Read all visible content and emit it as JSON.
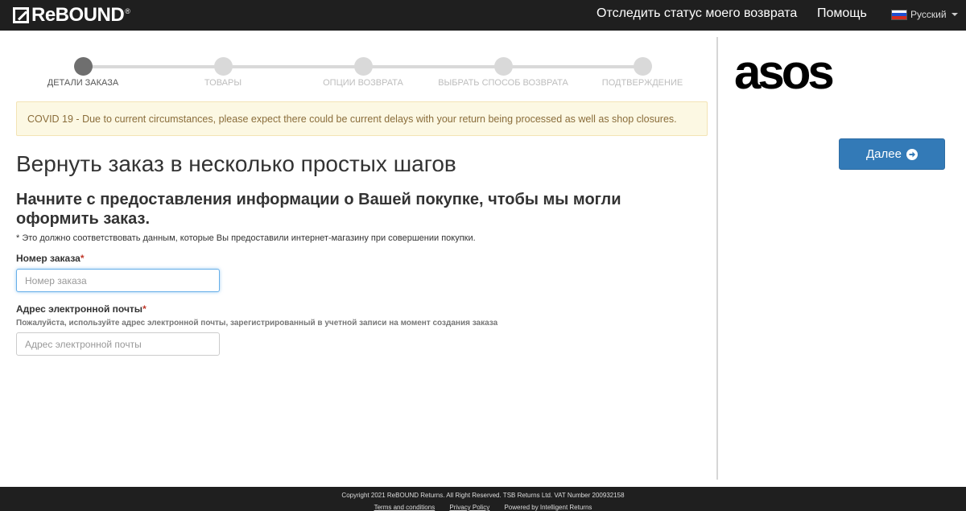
{
  "header": {
    "logo_text": "ReBOUND",
    "logo_reg": "®",
    "nav_track": "Отследить статус моего возврата",
    "nav_help": "Помощь",
    "language": "Русский"
  },
  "stepper": {
    "steps": [
      {
        "label": "ДЕТАЛИ ЗАКАЗА",
        "active": true
      },
      {
        "label": "ТОВАРЫ",
        "active": false
      },
      {
        "label": "ОПЦИИ ВОЗВРАТА",
        "active": false
      },
      {
        "label": "ВЫБРАТЬ СПОСОБ ВОЗВРАТА",
        "active": false
      },
      {
        "label": "ПОДТВЕРЖДЕНИЕ",
        "active": false
      }
    ]
  },
  "notice": "COVID 19 - Due to current circumstances, please expect there could be current delays with your return being processed as well as shop closures.",
  "main": {
    "title": "Вернуть заказ в несколько простых шагов",
    "subtitle": "Начните с предоставления информации о Вашей покупке, чтобы мы могли оформить заказ.",
    "note": "* Это должно соответствовать данным, которые Вы предоставили интернет-магазину при совершении покупки.",
    "order_label": "Номер заказа",
    "order_placeholder": "Номер заказа",
    "order_value": "",
    "email_label": "Адрес электронной почты",
    "email_hint": "Пожалуйста, используйте адрес электронной почты, зарегистрированный в учетной записи на момент создания заказа",
    "email_placeholder": "Адрес электронной почты",
    "email_value": "",
    "required_mark": "*"
  },
  "sidebar": {
    "brand": "asos",
    "next_label": "Далее"
  },
  "footer": {
    "copyright": "Copyright 2021 ReBOUND Returns. All Right Reserved. TSB Returns Ltd. VAT Number 200932158",
    "terms": "Terms and conditions",
    "privacy": "Privacy Policy",
    "powered": "Powered by Intelligent Returns"
  },
  "colors": {
    "topbar": "#1f1f1f",
    "primary_button": "#337ab7",
    "notice_bg": "#fcf8e3",
    "notice_text": "#8a6d3b",
    "required": "#c0392b"
  }
}
